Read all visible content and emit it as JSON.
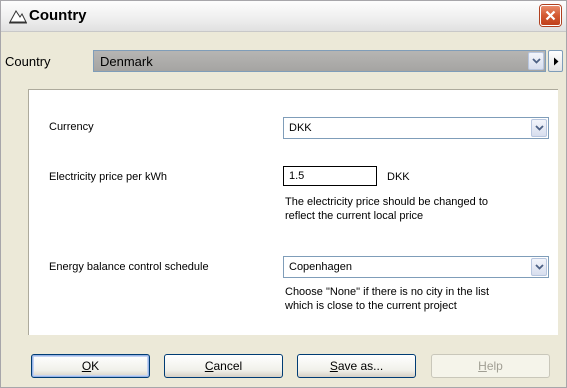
{
  "window": {
    "title": "Country",
    "close_icon": "close-icon",
    "title_icon": "window-icon"
  },
  "country_bar": {
    "label": "Country",
    "value": "Denmark"
  },
  "settings": {
    "currency": {
      "label": "Currency",
      "value": "DKK"
    },
    "electricity": {
      "label": "Electricity price per kWh",
      "value": "1.5",
      "unit": "DKK",
      "note_line1": "The electricity price should be changed to",
      "note_line2": "reflect the current local price"
    },
    "schedule": {
      "label": "Energy balance control schedule",
      "value": "Copenhagen",
      "note_line1": "Choose \"None\" if there is no city in the list",
      "note_line2": "which is close to the current project"
    }
  },
  "buttons": {
    "ok": {
      "mnemonic": "O",
      "rest": "K"
    },
    "cancel": {
      "mnemonic": "C",
      "rest": "ancel"
    },
    "save_as": {
      "mnemonic": "S",
      "rest": "ave as..."
    },
    "help": {
      "mnemonic": "H",
      "rest": "elp"
    }
  },
  "colors": {
    "accent": "#003c74",
    "close": "#d35a32"
  }
}
